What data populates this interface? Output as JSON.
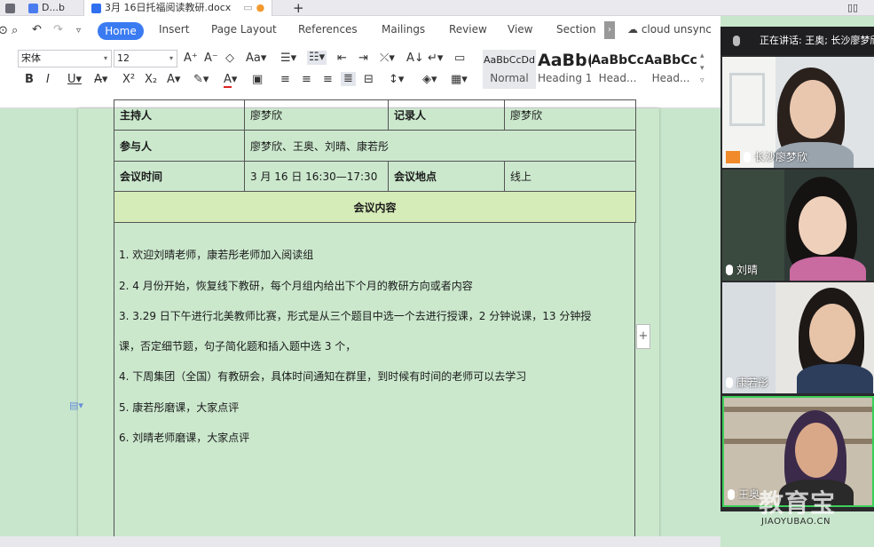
{
  "tabs": {
    "tab1": "D...b",
    "active": "3月 16日托福阅读教研.docx"
  },
  "menu": {
    "home": "Home",
    "insert": "Insert",
    "page_layout": "Page Layout",
    "references": "References",
    "mailings": "Mailings",
    "review": "Review",
    "view": "View",
    "section": "Section",
    "cloud": "cloud unsync"
  },
  "font": {
    "name": "宋体",
    "size": "12"
  },
  "styles": [
    {
      "preview": "AaBbCcDd",
      "name": "Normal"
    },
    {
      "preview": "AaBb(",
      "name": "Heading 1"
    },
    {
      "preview": "AaBbCc",
      "name": "Head..."
    },
    {
      "preview": "AaBbCc",
      "name": "Head..."
    }
  ],
  "table": {
    "host_label": "主持人",
    "host_value": "廖梦欣",
    "recorder_label": "记录人",
    "recorder_value": "廖梦欣",
    "participants_label": "参与人",
    "participants_value": "廖梦欣、王奥、刘晴、康若彤",
    "time_label": "会议时间",
    "time_value": "3 月 16 日  16:30—17:30",
    "place_label": "会议地点",
    "place_value": "线上",
    "content_header": "会议内容"
  },
  "content_items": [
    "1. 欢迎刘晴老师，康若彤老师加入阅读组",
    "2. 4 月份开始，恢复线下教研，每个月组内给出下个月的教研方向或者内容",
    "3. 3.29 日下午进行北美教师比赛，形式是从三个题目中选一个去进行授课，2 分钟说课，13 分钟授",
    "课，否定细节题，句子简化题和插入题中选 3 个，",
    "4. 下周集团（全国）有教研会，具体时间通知在群里，到时候有时间的老师可以去学习",
    "5. 康若彤磨课，大家点评",
    "6. 刘晴老师磨课，大家点评"
  ],
  "meeting": {
    "speaking": "正在讲话: 王奥; 长沙廖梦欣",
    "participants": [
      "长沙廖梦欣",
      "刘晴",
      "康若彤",
      "王奥"
    ]
  },
  "watermark": {
    "main": "教育宝",
    "sub": "JIAOYUBAO.CN"
  },
  "colors": {
    "accent": "#3b7bf2",
    "doc_bg": "#c8e6cc",
    "header_row": "#d6ecb8"
  }
}
